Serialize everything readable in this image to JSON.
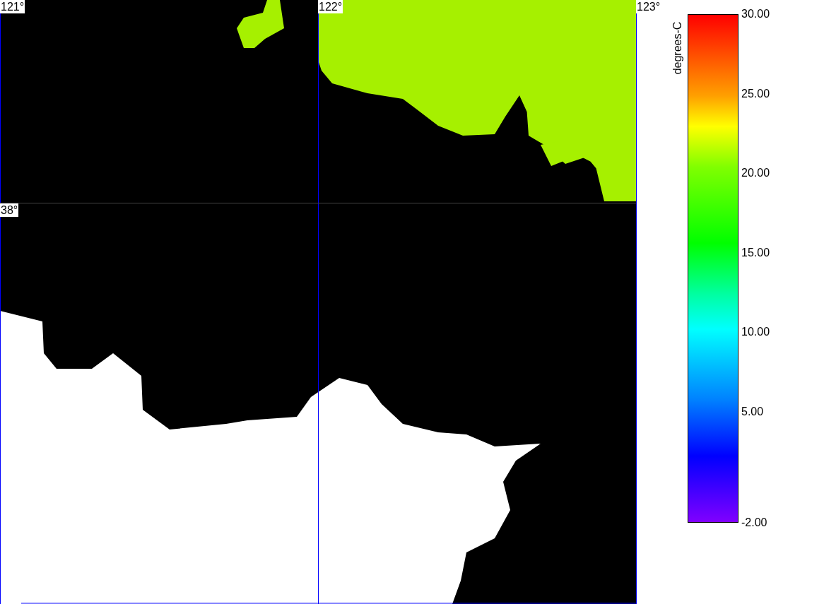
{
  "map": {
    "longitude_labels": [
      "121°",
      "122°",
      "123°"
    ],
    "latitude_labels": [
      "38°"
    ]
  },
  "legend": {
    "unit": "degrees-C",
    "ticks": [
      "30.00",
      "25.00",
      "20.00",
      "15.00",
      "10.00",
      "5.00",
      "-2.00"
    ]
  }
}
